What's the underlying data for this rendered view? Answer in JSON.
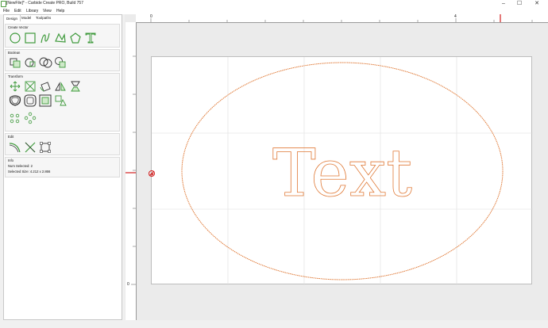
{
  "window": {
    "title": "[NewFile]* - Carbide Create PRO, Build 757"
  },
  "menu": [
    "File",
    "Edit",
    "Library",
    "View",
    "Help"
  ],
  "tabs": [
    "Design",
    "Model",
    "Toolpaths"
  ],
  "sections": {
    "create_vector": "Create Vector",
    "boolean": "Boolean",
    "transform": "Transform",
    "edit": "Edit",
    "info": "Info"
  },
  "info": {
    "num_selected": "Num Selected: 2",
    "selected_size": "Selected Size: 4.212 x 2.866"
  },
  "ruler": {
    "top_labels": [
      "0",
      "4"
    ],
    "left_labels": [
      "0"
    ]
  },
  "canvas": {
    "text_object": "Text",
    "outline_color": "#e07b39",
    "grid_color": "#dddddd"
  },
  "icons": {
    "create_vector": [
      "circle-icon",
      "rectangle-icon",
      "curve-icon",
      "polyline-icon",
      "polygon-icon",
      "text-icon"
    ],
    "boolean": [
      "weld-icon",
      "subtract-icon",
      "intersect-icon",
      "trim-icon"
    ],
    "transform": [
      "align-icon",
      "scale-icon",
      "rotate-icon",
      "mirror-icon",
      "flip-icon",
      "offset-icon",
      "rounded-offset-icon",
      "inset-icon",
      "fit-icon",
      "linear-array-icon",
      "circular-array-icon"
    ],
    "edit": [
      "node-edit-icon",
      "cut-icon",
      "join-icon"
    ]
  },
  "colors": {
    "accent_green": "#3f9a3c",
    "marker_red": "#d32020"
  }
}
